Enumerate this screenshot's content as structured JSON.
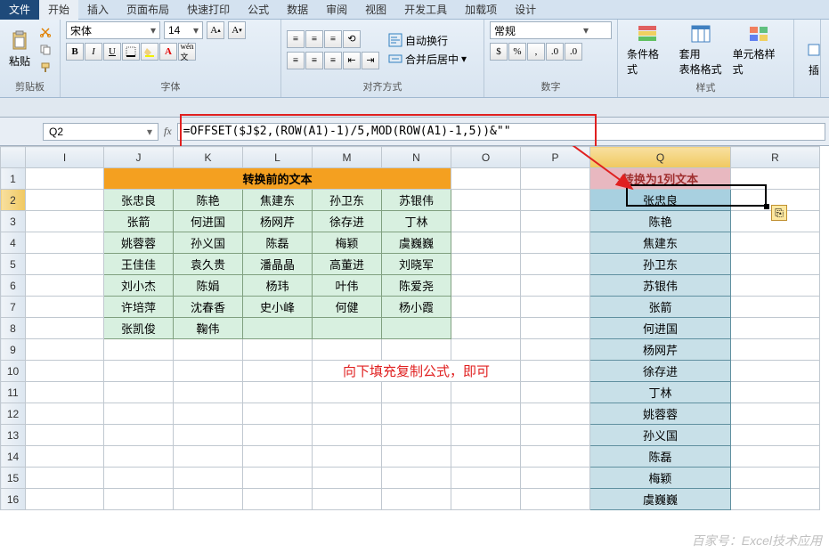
{
  "menu": {
    "file": "文件",
    "tabs": [
      "开始",
      "插入",
      "页面布局",
      "快速打印",
      "公式",
      "数据",
      "审阅",
      "视图",
      "开发工具",
      "加载项",
      "设计"
    ]
  },
  "ribbon": {
    "clipboard": {
      "label": "剪贴板",
      "paste": "粘贴"
    },
    "font": {
      "label": "字体",
      "name": "宋体",
      "size": "14",
      "bold": "B",
      "italic": "I",
      "underline": "U"
    },
    "align": {
      "label": "对齐方式",
      "wrap": "自动换行",
      "merge": "合并后居中"
    },
    "number": {
      "label": "数字",
      "format": "常规"
    },
    "styles": {
      "label": "样式",
      "cond": "条件格式",
      "table": "套用\n表格格式",
      "cell": "单元格样式"
    },
    "insert": "插"
  },
  "fbar": {
    "name": "Q2",
    "fx": "fx",
    "formula": "=OFFSET($J$2,(ROW(A1)-1)/5,MOD(ROW(A1)-1,5))&\"\""
  },
  "cols": [
    "I",
    "J",
    "K",
    "L",
    "M",
    "N",
    "O",
    "P",
    "Q",
    "R"
  ],
  "rows": [
    "1",
    "2",
    "3",
    "4",
    "5",
    "6",
    "7",
    "8",
    "9",
    "10",
    "11",
    "12",
    "13",
    "14",
    "15",
    "16"
  ],
  "table1": {
    "header": "转换前的文本",
    "rows": [
      [
        "张忠良",
        "陈艳",
        "焦建东",
        "孙卫东",
        "苏银伟"
      ],
      [
        "张箭",
        "何进国",
        "杨网芹",
        "徐存进",
        "丁林"
      ],
      [
        "姚蓉蓉",
        "孙义国",
        "陈磊",
        "梅颖",
        "虞巍巍"
      ],
      [
        "王佳佳",
        "袁久贵",
        "潘晶晶",
        "高董进",
        "刘晓军"
      ],
      [
        "刘小杰",
        "陈娟",
        "杨玮",
        "叶伟",
        "陈爱尧"
      ],
      [
        "许培萍",
        "沈春香",
        "史小峰",
        "何健",
        "杨小霞"
      ],
      [
        "张凯俊",
        "鞠伟",
        "",
        "",
        ""
      ]
    ]
  },
  "table2": {
    "header": "转换为1列文本",
    "rows": [
      "张忠良",
      "陈艳",
      "焦建东",
      "孙卫东",
      "苏银伟",
      "张箭",
      "何进国",
      "杨网芹",
      "徐存进",
      "丁林",
      "姚蓉蓉",
      "孙义国",
      "陈磊",
      "梅颖",
      "虞巍巍"
    ]
  },
  "note": "向下填充复制公式，即可",
  "watermark": "百家号：Excel技术应用"
}
